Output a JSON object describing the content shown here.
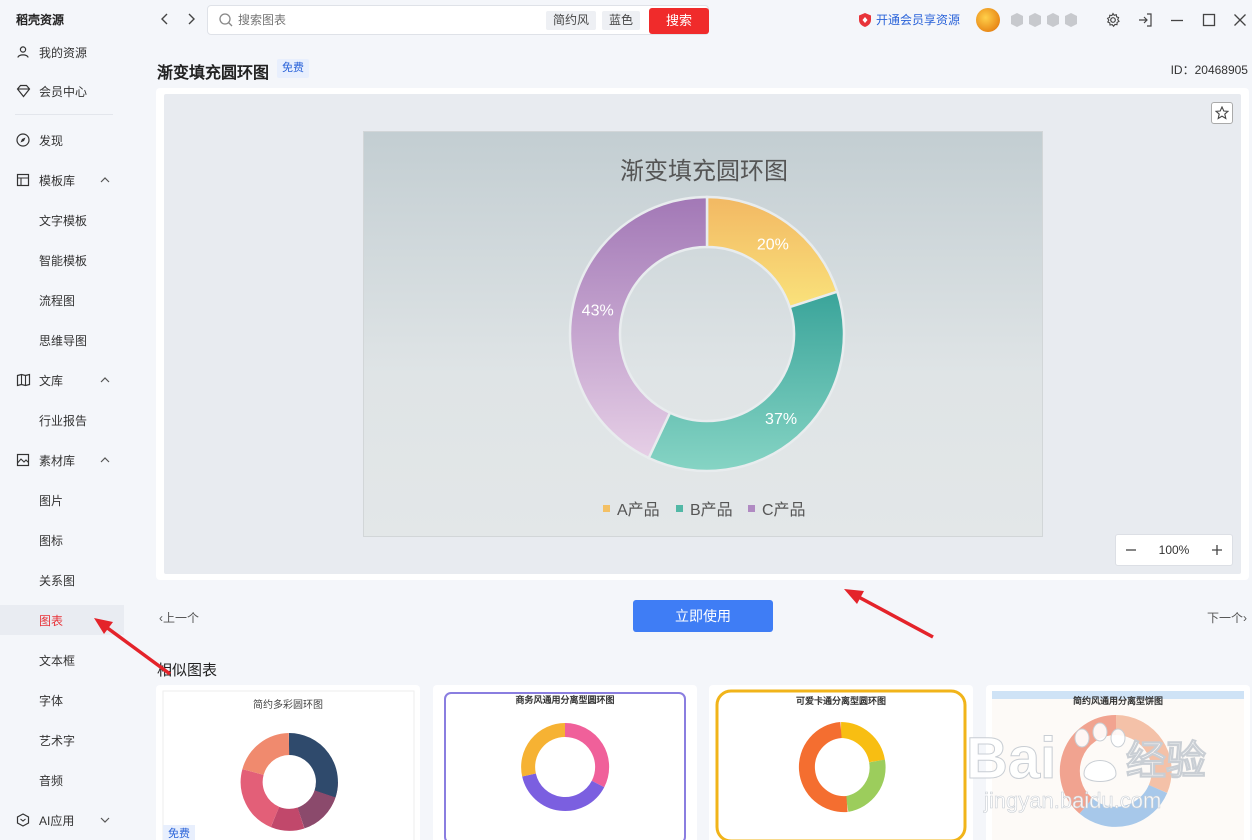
{
  "sidebar": {
    "brand": "稻壳资源",
    "items": [
      {
        "label": "我的资源",
        "icon": "user-icon"
      },
      {
        "label": "会员中心",
        "icon": "diamond-icon"
      },
      {
        "label": "发现",
        "icon": "compass-icon"
      },
      {
        "label": "模板库",
        "icon": "template-icon"
      },
      {
        "label": "文字模板"
      },
      {
        "label": "智能模板"
      },
      {
        "label": "流程图"
      },
      {
        "label": "思维导图"
      },
      {
        "label": "文库",
        "icon": "book-icon"
      },
      {
        "label": "行业报告"
      },
      {
        "label": "素材库",
        "icon": "image-icon"
      },
      {
        "label": "图片"
      },
      {
        "label": "图标"
      },
      {
        "label": "关系图"
      },
      {
        "label": "图表"
      },
      {
        "label": "文本框"
      },
      {
        "label": "字体"
      },
      {
        "label": "艺术字"
      },
      {
        "label": "音频"
      },
      {
        "label": "AI应用",
        "icon": "ai-icon"
      }
    ]
  },
  "topbar": {
    "search_placeholder": "搜索图表",
    "chip1": "简约风",
    "chip2": "蓝色",
    "search_button": "搜索",
    "vip_link": "开通会员享资源"
  },
  "page": {
    "title": "渐变填充圆环图",
    "free_tag": "免费",
    "id_label": "ID：20468905"
  },
  "zoom": "100%",
  "pager": {
    "prev": "上一个",
    "next": "下一个",
    "use_button": "立即使用"
  },
  "similar": {
    "title": "相似图表",
    "thumbs": [
      {
        "title": "简约多彩圆环图",
        "free": "免费"
      },
      {
        "title": "商务风通用分离型圆环图"
      },
      {
        "title": "可爱卡通分离型圆环图"
      },
      {
        "title": "简约风通用分离型饼图"
      }
    ]
  },
  "watermark": {
    "text": "Bai",
    "text2": "经验",
    "url": "jingyan.baidu.com"
  },
  "chart_data": {
    "type": "pie",
    "title": "渐变填充圆环图",
    "categories": [
      "A产品",
      "B产品",
      "C产品"
    ],
    "values": [
      20,
      37,
      43
    ],
    "labels": [
      "20%",
      "37%",
      "43%"
    ],
    "colors": [
      "#f3c065",
      "#52b8a6",
      "#b08ac2"
    ],
    "legend": "bottom"
  }
}
